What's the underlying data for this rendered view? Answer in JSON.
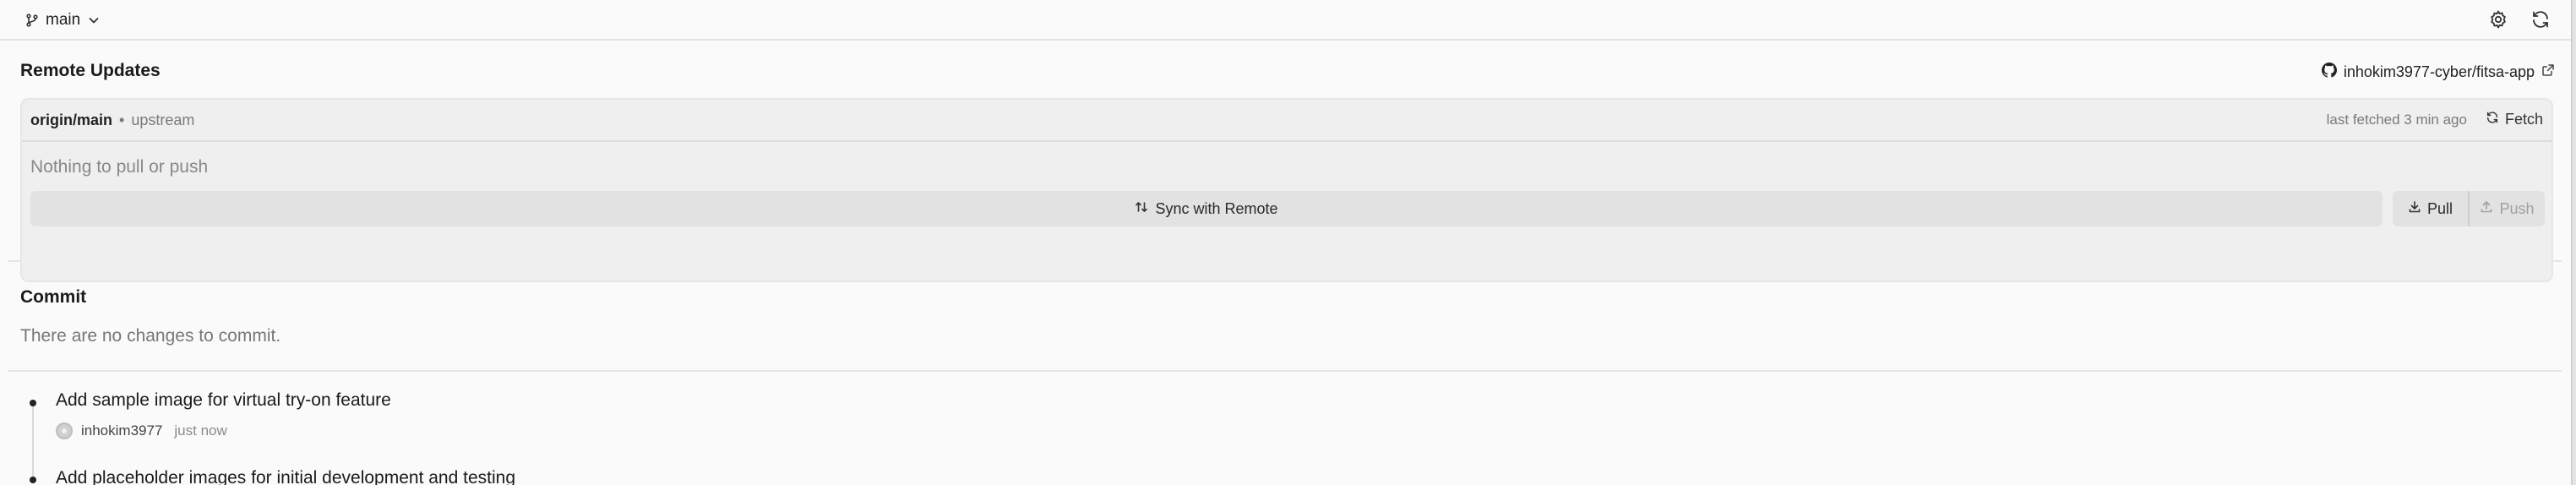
{
  "topbar": {
    "branch_name": "main",
    "icons": {
      "branch": "git-branch-icon",
      "dropdown": "chevron-down-icon",
      "settings": "gear-icon",
      "refresh": "refresh-icon"
    }
  },
  "remote": {
    "title": "Remote Updates",
    "repo": "inhokim3977-cyber/fitsa-app",
    "upstream_branch": "origin/main",
    "separator": "•",
    "upstream_label": "upstream",
    "last_fetched": "last fetched 3 min ago",
    "fetch_label": "Fetch",
    "status_text": "Nothing to pull or push",
    "sync_label": "Sync with Remote",
    "pull_label": "Pull",
    "push_label": "Push"
  },
  "commit": {
    "title": "Commit",
    "empty_text": "There are no changes to commit."
  },
  "history": [
    {
      "message": "Add sample image for virtual try-on feature",
      "author": "inhokim3977",
      "time": "just now"
    },
    {
      "message": "Add placeholder images for initial development and testing",
      "author": "",
      "time": ""
    }
  ],
  "colors": {
    "background": "#fafafa",
    "card": "#efefef",
    "button": "#e2e2e2",
    "muted_text": "#888888"
  }
}
